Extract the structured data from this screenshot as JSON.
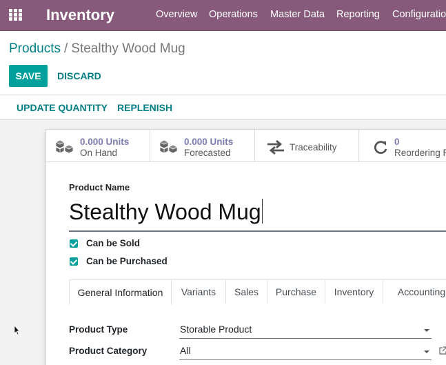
{
  "navbar": {
    "app_title": "Inventory",
    "menu": [
      "Overview",
      "Operations",
      "Master Data",
      "Reporting",
      "Configuration"
    ]
  },
  "breadcrumb": {
    "parent": "Products",
    "separator": "/",
    "current": "Stealthy Wood Mug"
  },
  "actions": {
    "save": "SAVE",
    "discard": "DISCARD"
  },
  "statusbar": {
    "update_quantity": "UPDATE QUANTITY",
    "replenish": "REPLENISH"
  },
  "smart_buttons": {
    "on_hand": {
      "value": "0.000 Units",
      "label": "On Hand",
      "icon": "cubes-icon"
    },
    "forecasted": {
      "value": "0.000 Units",
      "label": "Forecasted",
      "icon": "cubes-icon"
    },
    "traceability": {
      "label": "Traceability",
      "icon": "exchange-arrows-icon"
    },
    "reordering": {
      "value": "0",
      "label": "Reordering Rules",
      "icon": "refresh-icon"
    }
  },
  "form": {
    "name_label": "Product Name",
    "name_value": "Stealthy Wood Mug",
    "can_be_sold": {
      "label": "Can be Sold",
      "checked": true
    },
    "can_be_purchased": {
      "label": "Can be Purchased",
      "checked": true
    },
    "tabs": [
      "General Information",
      "Variants",
      "Sales",
      "Purchase",
      "Inventory",
      "Accounting"
    ],
    "active_tab": "General Information",
    "product_type": {
      "label": "Product Type",
      "value": "Storable Product"
    },
    "product_category": {
      "label": "Product Category",
      "value": "All"
    }
  },
  "colors": {
    "navbar": "#875a7b",
    "primary": "#00a09d",
    "link": "#017e84",
    "smart_value": "#7c7bad"
  }
}
